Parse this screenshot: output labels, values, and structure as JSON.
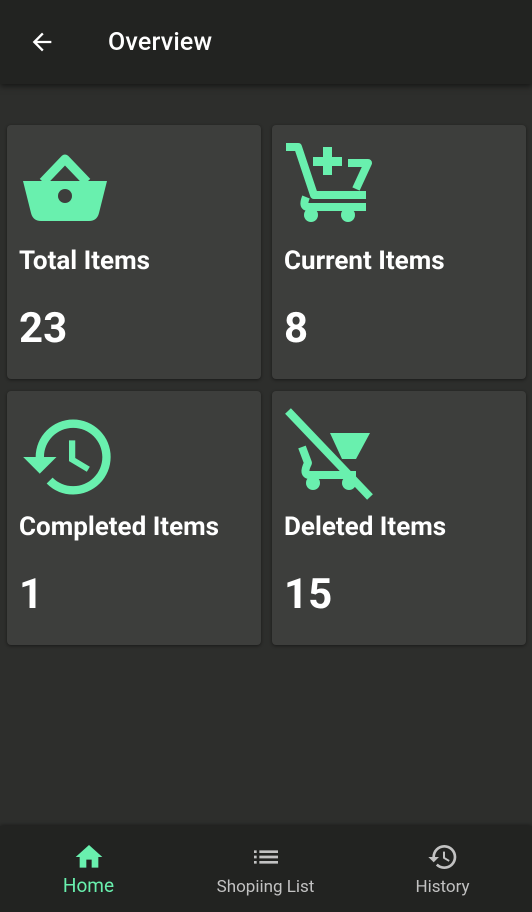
{
  "app_bar": {
    "title": "Overview",
    "back_icon": "arrow-left-icon"
  },
  "colors": {
    "accent": "#69f0ae",
    "background": "#2d2e2c",
    "bar": "#222321",
    "card": "#3d3e3c",
    "inactive_nav": "#c2c2c2"
  },
  "cards": [
    {
      "label": "Total Items",
      "value": "23",
      "icon": "shopping-basket-icon"
    },
    {
      "label": "Current Items",
      "value": "8",
      "icon": "add-shopping-cart-icon"
    },
    {
      "label": "Completed Items",
      "value": "1",
      "icon": "history-icon"
    },
    {
      "label": "Deleted Items",
      "value": "15",
      "icon": "remove-shopping-cart-icon"
    }
  ],
  "bottom_nav": {
    "items": [
      {
        "label": "Home",
        "icon": "home-icon",
        "active": true
      },
      {
        "label": "Shopiing List",
        "icon": "list-icon",
        "active": false
      },
      {
        "label": "History",
        "icon": "history-icon",
        "active": false
      }
    ]
  }
}
